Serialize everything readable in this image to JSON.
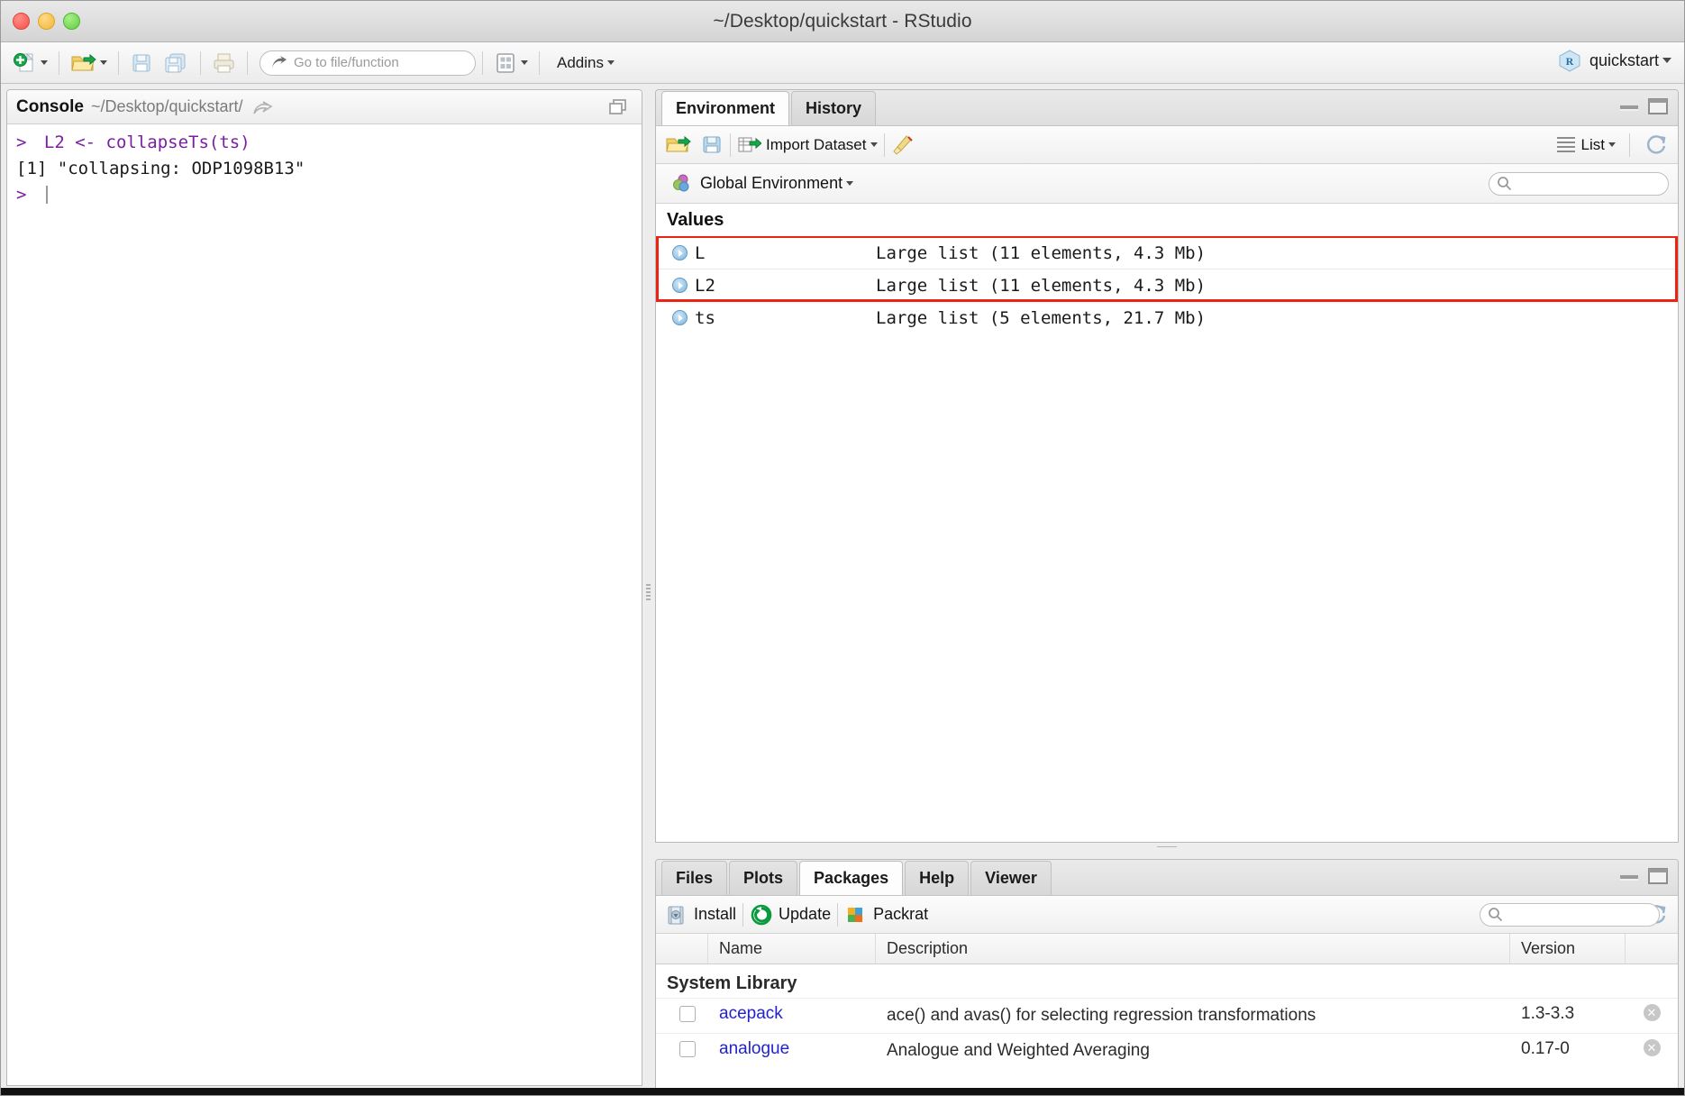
{
  "window": {
    "title": "~/Desktop/quickstart - RStudio",
    "traffic_lights": [
      "close",
      "minimize",
      "zoom"
    ]
  },
  "toolbar": {
    "new_file_label": "new-file",
    "open_file_label": "open-file",
    "save_label": "save",
    "save_all_label": "save-all",
    "print_label": "print",
    "goto_placeholder": "Go to file/function",
    "panes_label": "workspace-panes",
    "addins_label": "Addins",
    "project_label": "quickstart"
  },
  "console": {
    "title": "Console",
    "path": "~/Desktop/quickstart/",
    "lines": [
      {
        "type": "input",
        "prompt": ">",
        "text": "L2 <- collapseTs(ts)"
      },
      {
        "type": "output",
        "prompt": "",
        "text": "[1] \"collapsing: ODP1098B13\""
      },
      {
        "type": "prompt",
        "prompt": ">",
        "text": ""
      }
    ]
  },
  "environment": {
    "tabs": [
      {
        "label": "Environment",
        "active": true
      },
      {
        "label": "History",
        "active": false
      }
    ],
    "toolbar": {
      "load_workspace_label": "load-workspace",
      "save_workspace_label": "save-workspace",
      "import_dataset_label": "Import Dataset",
      "clear_label": "clear-objects",
      "view_mode_label": "List",
      "refresh_label": "refresh"
    },
    "scope": "Global Environment",
    "search_placeholder": "",
    "section_title": "Values",
    "rows": [
      {
        "name": "L",
        "value": "Large list (11 elements, 4.3 Mb)",
        "highlighted": true
      },
      {
        "name": "L2",
        "value": "Large list (11 elements, 4.3 Mb)",
        "highlighted": true
      },
      {
        "name": "ts",
        "value": "Large list (5 elements, 21.7 Mb)",
        "highlighted": false
      }
    ]
  },
  "packages": {
    "tabs": [
      {
        "label": "Files",
        "active": false
      },
      {
        "label": "Plots",
        "active": false
      },
      {
        "label": "Packages",
        "active": true
      },
      {
        "label": "Help",
        "active": false
      },
      {
        "label": "Viewer",
        "active": false
      }
    ],
    "toolbar": {
      "install_label": "Install",
      "update_label": "Update",
      "packrat_label": "Packrat",
      "search_placeholder": "",
      "refresh_label": "refresh"
    },
    "columns": [
      "",
      "Name",
      "Description",
      "Version",
      ""
    ],
    "section_title": "System Library",
    "rows": [
      {
        "checked": false,
        "name": "acepack",
        "description": "ace() and avas() for selecting regression transformations",
        "version": "1.3-3.3"
      },
      {
        "checked": false,
        "name": "analogue",
        "description": "Analogue and Weighted Averaging",
        "version": "0.17-0"
      }
    ]
  },
  "colors": {
    "highlight": "#ee2211",
    "console_input": "#7b1fa2",
    "link": "#2222cc"
  }
}
